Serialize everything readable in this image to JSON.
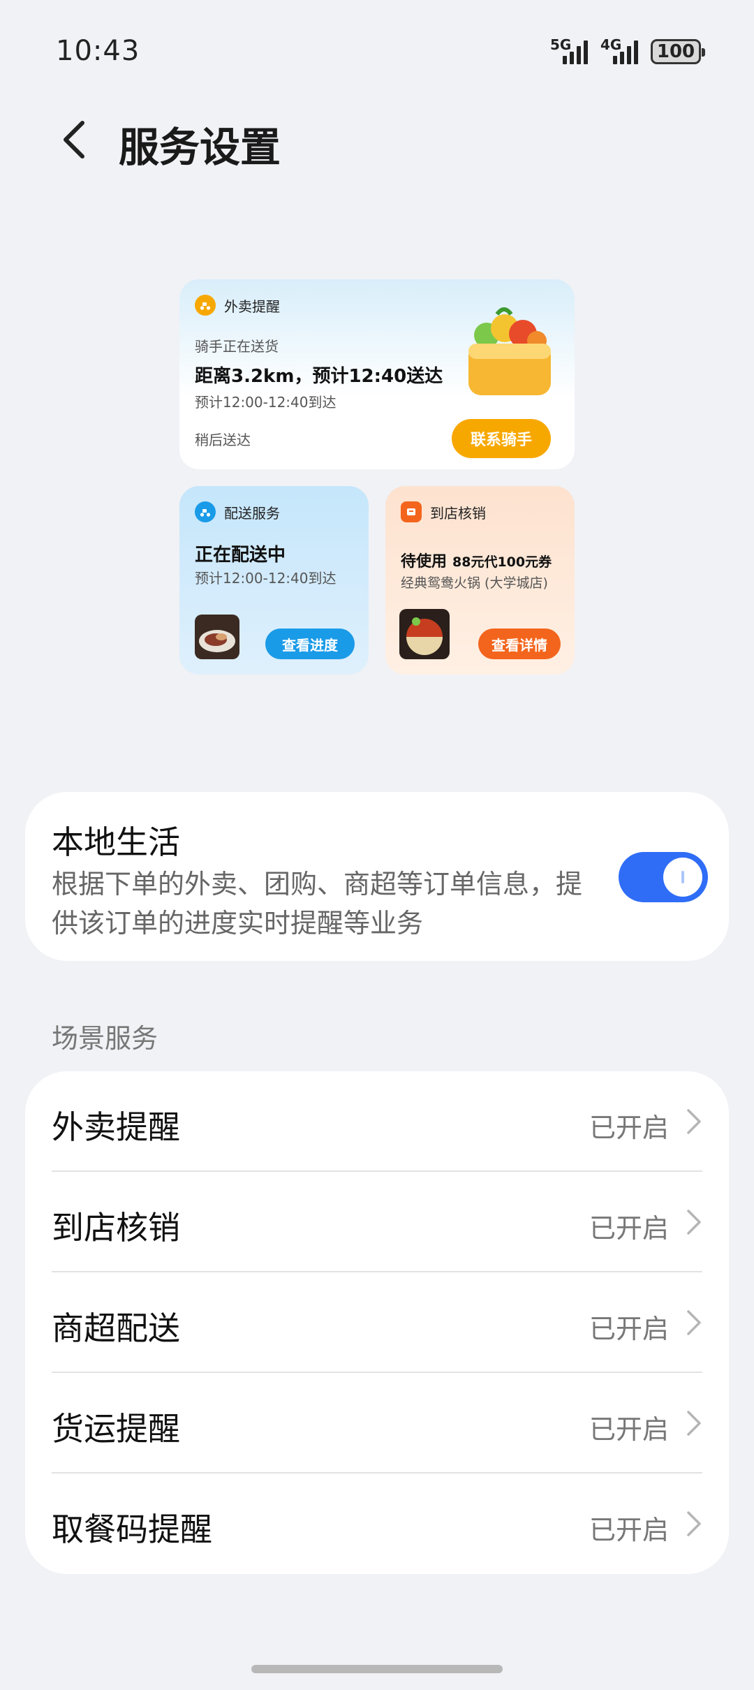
{
  "status_bar": {
    "time": "10:43",
    "signal1": "5G",
    "signal2": "4G",
    "battery": "100"
  },
  "header": {
    "title": "服务设置"
  },
  "preview": {
    "big_card": {
      "name": "外卖提醒",
      "line1": "骑手正在送货",
      "headline": "距离3.2km，预计12:40送达",
      "line2": "预计12:00-12:40到达",
      "footer": "稍后送达",
      "button": "联系骑手",
      "accent": "#f7a800"
    },
    "left_card": {
      "name": "配送服务",
      "headline": "正在配送中",
      "line1": "预计12:00-12:40到达",
      "button": "查看进度",
      "accent": "#1a9be8"
    },
    "right_card": {
      "name": "到店核销",
      "headline_prefix": "待使用",
      "headline_suffix": "88元代100元券",
      "line1": "经典鸳鸯火锅 (大学城店)",
      "button": "查看详情",
      "accent": "#f3651c"
    }
  },
  "local_life": {
    "title": "本地生活",
    "description": "根据下单的外卖、团购、商超等订单信息，提供该订单的进度实时提醒等业务",
    "enabled": true,
    "toggle_color": "#2f6df6"
  },
  "scene_services": {
    "label": "场景服务",
    "items": [
      {
        "label": "外卖提醒",
        "status": "已开启"
      },
      {
        "label": "到店核销",
        "status": "已开启"
      },
      {
        "label": "商超配送",
        "status": "已开启"
      },
      {
        "label": "货运提醒",
        "status": "已开启"
      },
      {
        "label": "取餐码提醒",
        "status": "已开启"
      }
    ]
  }
}
